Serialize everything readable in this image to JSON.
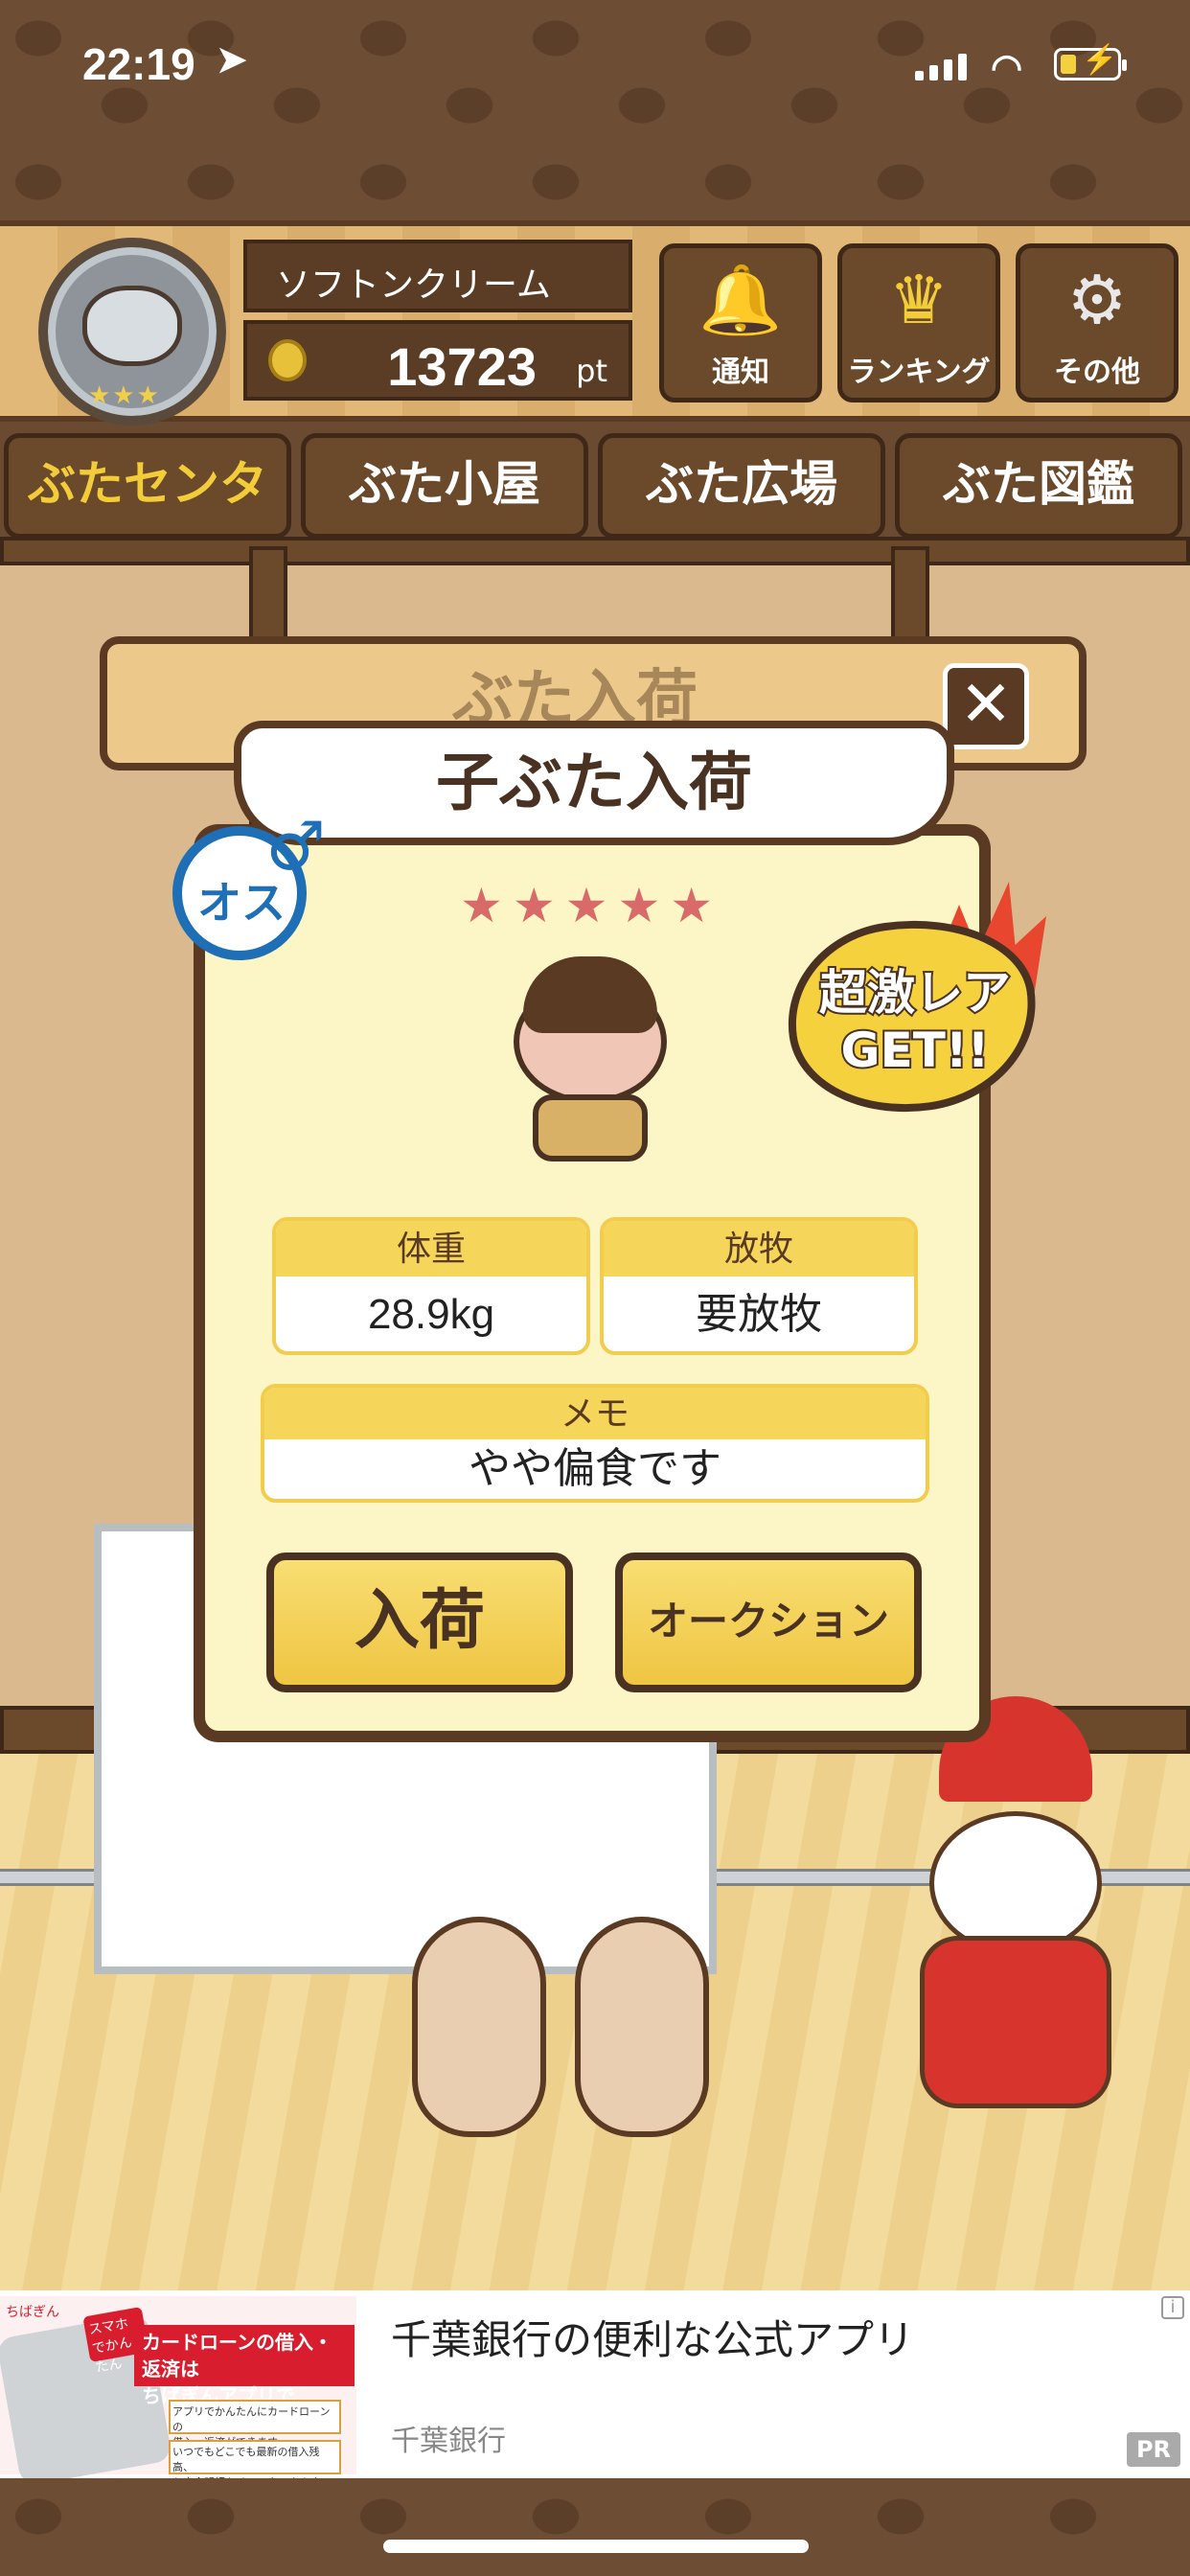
{
  "status_bar": {
    "time": "22:19",
    "location_icon": "➤",
    "wifi_icon": "wifi",
    "battery_icon": "charging"
  },
  "header": {
    "player_name": "ソフトンクリーム",
    "points": "13723",
    "points_unit": "pt",
    "avatar_stars": "★★★",
    "buttons": [
      {
        "label": "通知",
        "icon": "bell-icon"
      },
      {
        "label": "ランキング",
        "icon": "crown-icon"
      },
      {
        "label": "その他",
        "icon": "gear-icon"
      }
    ]
  },
  "tabs": [
    {
      "label": "ぶたセンター",
      "active": true
    },
    {
      "label": "ぶた小屋",
      "active": false
    },
    {
      "label": "ぶた広場",
      "active": false
    },
    {
      "label": "ぶた図鑑",
      "active": false
    }
  ],
  "background_sign": "ぶた入荷",
  "dialog": {
    "title": "子ぶた入荷",
    "close_label": "✕",
    "gender": {
      "label": "オス",
      "symbol": "♂"
    },
    "stars": "★★★★★",
    "rarity_label": "超激レア\nGET!!",
    "weight": {
      "label": "体重",
      "value": "28.9kg"
    },
    "grazing": {
      "label": "放牧",
      "value": "要放牧"
    },
    "memo": {
      "label": "メモ",
      "value": "やや偏食です"
    },
    "buttons": {
      "arrive": "入荷",
      "auction": "オークション"
    }
  },
  "ad": {
    "title": "千葉銀行の便利な公式アプリ",
    "advertiser": "千葉銀行",
    "badge": "PR",
    "info": "i",
    "creative": {
      "brand": "ちばぎん",
      "badge_text": "スマホでかんたん",
      "headline": "カードローンの借入・返済は\nちばぎんアプリで",
      "note1": "アプリでかんたんにカードローンの\n借入・返済ができます。",
      "note2": "いつでもどこでも最新の借入残高、\n入出金明細をチェックできます。"
    }
  },
  "colors": {
    "wood_dark": "#5a3a22",
    "accent_yellow": "#f3cc3a",
    "dialog_bg": "#fcf5c5",
    "male_blue": "#1e6fb6",
    "rare_pink": "#d86a6a"
  }
}
